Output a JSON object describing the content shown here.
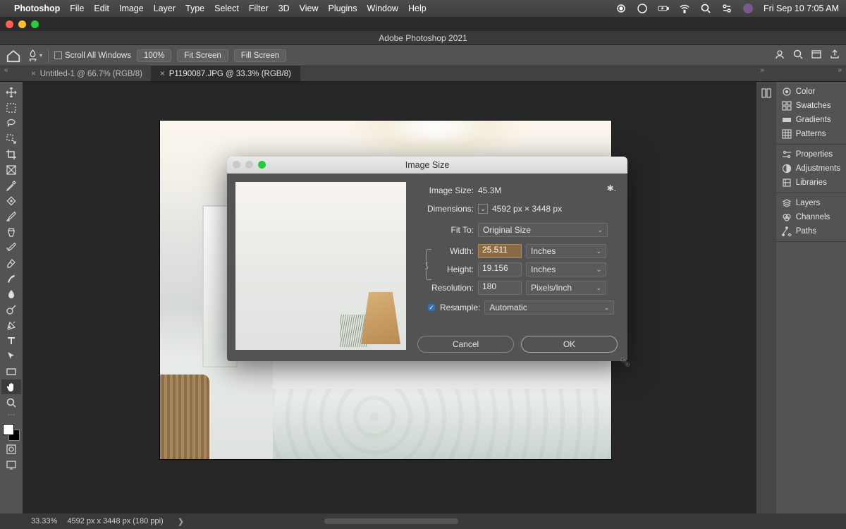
{
  "mac_menu": {
    "app_name": "Photoshop",
    "items": [
      "File",
      "Edit",
      "Image",
      "Layer",
      "Type",
      "Select",
      "Filter",
      "3D",
      "View",
      "Plugins",
      "Window",
      "Help"
    ],
    "clock": "Fri Sep 10  7:05 AM"
  },
  "window": {
    "title": "Adobe Photoshop 2021"
  },
  "options_bar": {
    "scroll_all": "Scroll All Windows",
    "zoom": "100%",
    "fit_screen": "Fit Screen",
    "fill_screen": "Fill Screen"
  },
  "tabs": [
    {
      "label": "Untitled-1 @ 66.7% (RGB/8)",
      "active": false
    },
    {
      "label": "P1190087.JPG @ 33.3% (RGB/8)",
      "active": true
    }
  ],
  "panels": {
    "group1": [
      "Color",
      "Swatches",
      "Gradients",
      "Patterns"
    ],
    "group2": [
      "Properties",
      "Adjustments",
      "Libraries"
    ],
    "group3": [
      "Layers",
      "Channels",
      "Paths"
    ]
  },
  "status": {
    "zoom": "33.33%",
    "dims": "4592 px x 3448 px (180 ppi)"
  },
  "dialog": {
    "title": "Image Size",
    "image_size_label": "Image Size:",
    "image_size_value": "45.3M",
    "dimensions_label": "Dimensions:",
    "dimensions_value": "4592 px  ×  3448 px",
    "fit_to_label": "Fit To:",
    "fit_to_value": "Original Size",
    "width_label": "Width:",
    "width_value": "25.511",
    "height_label": "Height:",
    "height_value": "19.156",
    "wh_unit": "Inches",
    "resolution_label": "Resolution:",
    "resolution_value": "180",
    "resolution_unit": "Pixels/Inch",
    "resample_label": "Resample:",
    "resample_value": "Automatic",
    "cancel": "Cancel",
    "ok": "OK"
  }
}
